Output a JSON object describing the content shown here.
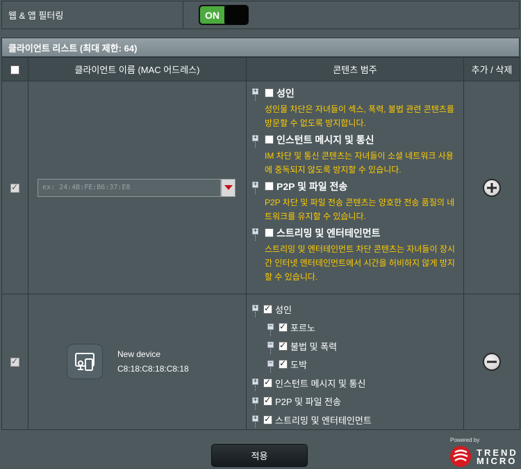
{
  "filter": {
    "label": "웹 & 앱 필터링",
    "toggle_label": "ON"
  },
  "client_list": {
    "title": "클라이언트 리스트 (최대 제한: 64)",
    "headers": {
      "name": "클라이언트 이름 (MAC 어드레스)",
      "category": "콘텐츠 범주",
      "action": "추가 / 삭제"
    }
  },
  "new_row": {
    "mac_placeholder": "ex: 24:4B:FE:B6:37:E8",
    "categories": [
      {
        "title": "성인",
        "desc": "성인물 차단은 자녀들이 섹스, 폭력, 불법 관련 콘텐츠를 방문할 수 없도록 방지합니다."
      },
      {
        "title": "인스턴트 메시지 및 통신",
        "desc": "IM 차단 및 통신 콘텐츠는 자녀들이 소셜 네트워크 사용에 중독되지 않도록 방지할 수 있습니다."
      },
      {
        "title": "P2P 및 파일 전송",
        "desc": "P2P 차단 및 파일 전송 콘텐츠는 양호한 전송 품질의 네트워크를 유지할 수 있습니다."
      },
      {
        "title": "스트리밍 및 엔터테인먼트",
        "desc": "스트리밍 및 엔터테인먼트 차단 콘텐츠는 자녀들이 장시간 인터넷 엔터테인먼트에서 시간을 허비하지 않게 방지할 수 있습니다."
      }
    ]
  },
  "device_row": {
    "device_name": "New device",
    "device_mac": "C8:18:C8:18:C8:18",
    "tree": [
      {
        "label": "성인",
        "level": 0
      },
      {
        "label": "포르노",
        "level": 1
      },
      {
        "label": "불법 및 폭력",
        "level": 1
      },
      {
        "label": "도박",
        "level": 1
      },
      {
        "label": "인스턴트 메시지 및 통신",
        "level": 0
      },
      {
        "label": "P2P 및 파일 전송",
        "level": 0
      },
      {
        "label": "스트리밍 및 엔터테인먼트",
        "level": 0
      }
    ]
  },
  "apply_label": "적용",
  "brand": {
    "powered_by": "Powered by",
    "name_line1": "TREND",
    "name_line2": "MICRO"
  }
}
